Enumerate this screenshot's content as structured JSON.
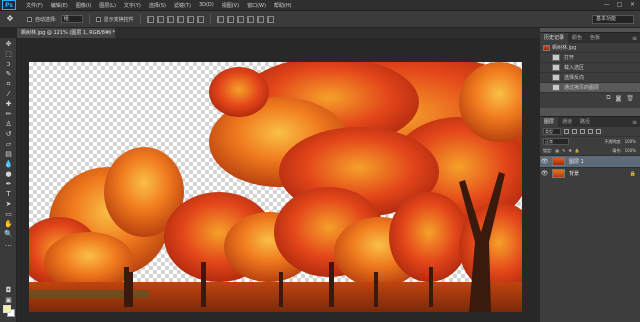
{
  "app": {
    "logo_text": "Ps"
  },
  "menu": {
    "items": [
      "文件(F)",
      "编辑(E)",
      "图像(I)",
      "图层(L)",
      "文字(Y)",
      "选择(S)",
      "滤镜(T)",
      "3D(D)",
      "视图(V)",
      "窗口(W)",
      "帮助(H)"
    ]
  },
  "window_controls": {
    "minimize": "—",
    "maximize": "□",
    "close": "✕"
  },
  "options": {
    "tool_icon": "move-tool-icon",
    "auto_select_label": "自动选择:",
    "auto_select_value": "组",
    "show_transform_label": "显示变换控件",
    "workspace": "基本功能"
  },
  "document_tab": {
    "title": "枫树林.jpg @ 121% (图层 1, RGB/8#) *",
    "close": "×"
  },
  "history_panel": {
    "tabs": [
      "历史记录",
      "颜色",
      "色板"
    ],
    "snapshot_label": "枫树林.jpg",
    "items": [
      "打开",
      "载入选区",
      "选择反向",
      "通过拷贝的图层"
    ],
    "selected_index": 3
  },
  "layers_panel": {
    "tabs": [
      "图层",
      "通道",
      "路径"
    ],
    "filter_kind": "类型",
    "blend_mode": "正常",
    "opacity_label": "不透明度:",
    "opacity_value": "100%",
    "lock_label": "锁定:",
    "fill_label": "填充:",
    "fill_value": "100%",
    "layers": [
      {
        "name": "图层 1",
        "selected": true,
        "locked": false
      },
      {
        "name": "背景",
        "selected": false,
        "locked": true
      }
    ]
  },
  "colors": {
    "foreground": "#f2f2a0",
    "background": "#ffffff",
    "foliage_main": "#e3461a",
    "foliage_light": "#f28a22"
  }
}
